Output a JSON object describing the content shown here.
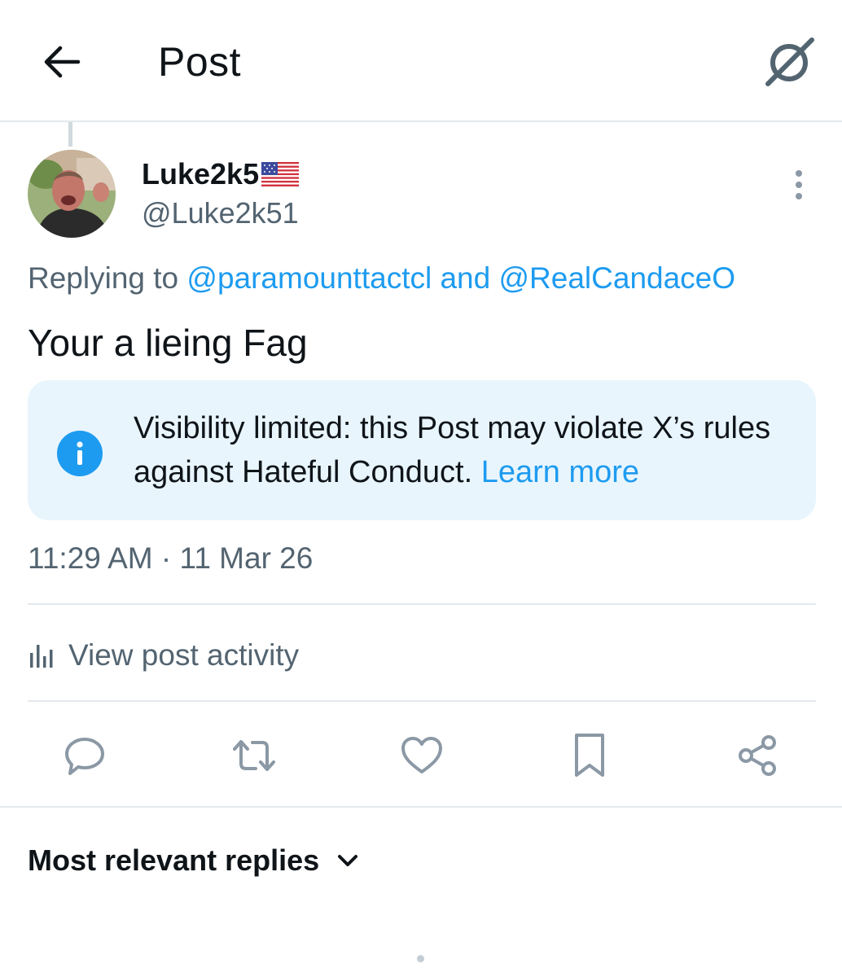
{
  "header": {
    "title": "Post",
    "back_icon": "arrow-left-icon",
    "grok_icon": "grok-icon"
  },
  "author": {
    "name": "Luke2k5",
    "flag": "us-flag-emoji",
    "handle": "@Luke2k51"
  },
  "reply_context": {
    "prefix": "Replying to",
    "mention_1": "@paramounttactcl",
    "joiner": "and",
    "mention_2": "@RealCandaceO"
  },
  "post": {
    "text": "Your a lieing Fag"
  },
  "notice": {
    "text": "Visibility limited: this Post may violate X’s rules against Hateful Conduct.",
    "link": "Learn more",
    "icon": "info-icon"
  },
  "timestamp": {
    "time": "11:29 AM",
    "separator": "·",
    "date": "11 Mar 26"
  },
  "activity": {
    "label": "View post activity",
    "icon": "bar-chart-icon"
  },
  "actions": [
    {
      "name": "reply",
      "icon": "comment-icon"
    },
    {
      "name": "repost",
      "icon": "repost-icon"
    },
    {
      "name": "like",
      "icon": "heart-icon"
    },
    {
      "name": "bookmark",
      "icon": "bookmark-icon"
    },
    {
      "name": "share",
      "icon": "share-icon"
    }
  ],
  "replies": {
    "sort_label": "Most relevant replies"
  },
  "colors": {
    "text_primary": "#0f1419",
    "text_secondary": "#536471",
    "accent": "#1d9bf0",
    "notice_background": "#e8f5fd",
    "divider": "#e4e9ed"
  }
}
